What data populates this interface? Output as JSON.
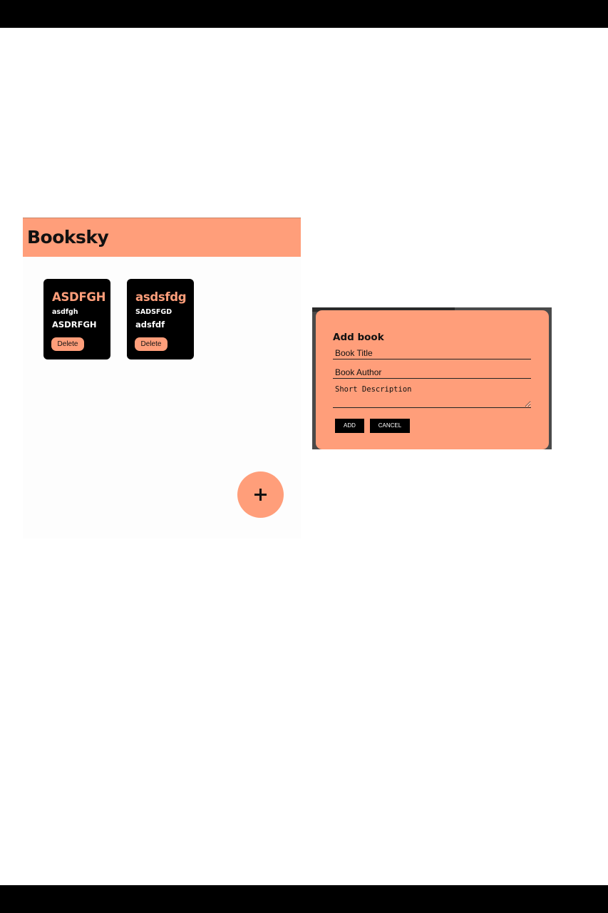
{
  "app": {
    "title": "Booksky",
    "books": [
      {
        "title": "ASDFGH",
        "author": "asdfgh",
        "description": "ASDRFGH",
        "delete_label": "Delete"
      },
      {
        "title": "asdsfdg",
        "author": "SADSFGD",
        "description": "adsfdf",
        "delete_label": "Delete"
      }
    ],
    "fab_icon": "plus-icon"
  },
  "dialog": {
    "title": "Add book",
    "title_placeholder": "Book Title",
    "author_placeholder": "Book Author",
    "description_placeholder": "Short Description",
    "add_label": "ADD",
    "cancel_label": "CANCEL"
  },
  "colors": {
    "accent": "#ff9e7a",
    "card_background": "#000000",
    "button_background": "#000000"
  }
}
